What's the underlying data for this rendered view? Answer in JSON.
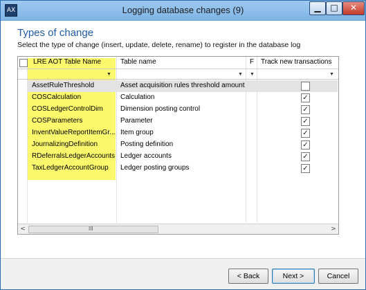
{
  "window": {
    "title": "Logging database changes (9)",
    "app_icon_glyph": "AX",
    "minimize_glyph": "▁",
    "maximize_glyph": "□",
    "close_glyph": "✕"
  },
  "page": {
    "heading": "Types of change",
    "subtitle": "Select the type of change (insert, update, delete, rename) to register in the database log"
  },
  "grid": {
    "columns": {
      "aot": "LRE AOT Table Name",
      "table": "Table name",
      "f": "F",
      "track": "Track new transactions"
    },
    "highlight_color": "#fbf96b",
    "rows": [
      {
        "aot": "AssetRuleThreshold",
        "table": "Asset acquisition rules threshold amount",
        "track": false
      },
      {
        "aot": "COSCalculation",
        "table": "Calculation",
        "track": true
      },
      {
        "aot": "COSLedgerControlDim",
        "table": "Dimension posting control",
        "track": true
      },
      {
        "aot": "COSParameters",
        "table": "Parameter",
        "track": true
      },
      {
        "aot": "InventValueReportItemGr...",
        "table": "Item group",
        "track": true
      },
      {
        "aot": "JournalizingDefinition",
        "table": "Posting definition",
        "track": true
      },
      {
        "aot": "RDeferralsLedgerAccounts",
        "table": "Ledger accounts",
        "track": true
      },
      {
        "aot": "TaxLedgerAccountGroup",
        "table": "Ledger posting groups",
        "track": true
      }
    ],
    "check_glyph": "✓",
    "scroll_left_glyph": "<",
    "scroll_right_glyph": ">",
    "scroll_thumb_glyph": "III"
  },
  "footer": {
    "back": "< Back",
    "next": "Next >",
    "cancel": "Cancel"
  }
}
